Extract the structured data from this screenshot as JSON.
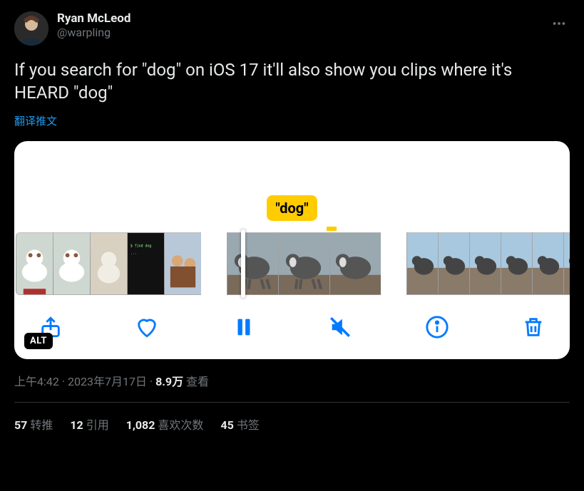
{
  "user": {
    "display_name": "Ryan McLeod",
    "handle": "@warpling"
  },
  "tweet_text": "If you search for \"dog\" on iOS 17 it'll also show you clips where it's HEARD \"dog\"",
  "translate_label": "翻译推文",
  "media": {
    "search_label": "\"dog\"",
    "alt_badge": "ALT"
  },
  "meta": {
    "time": "上午4:42",
    "date": "2023年7月17日",
    "views_count": "8.9万",
    "views_label": "查看",
    "separator": " · "
  },
  "stats": {
    "retweets_count": "57",
    "retweets_label": "转推",
    "quotes_count": "12",
    "quotes_label": "引用",
    "likes_count": "1,082",
    "likes_label": "喜欢次数",
    "bookmarks_count": "45",
    "bookmarks_label": "书签"
  }
}
